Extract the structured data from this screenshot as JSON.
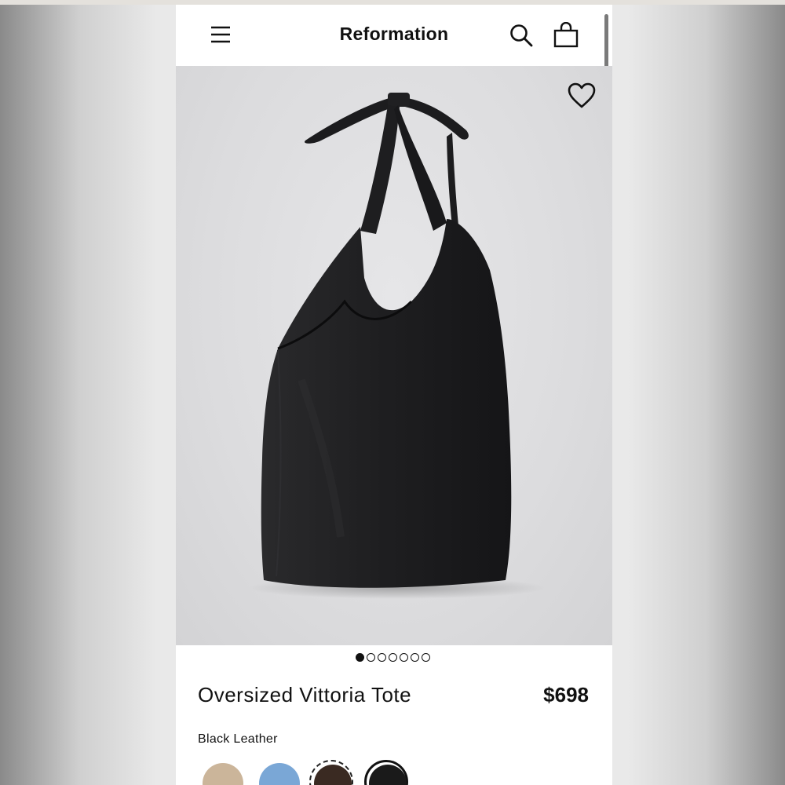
{
  "header": {
    "brand": "Reformation",
    "menu_icon": "hamburger-menu-icon",
    "search_icon": "search-icon",
    "bag_icon": "shopping-bag-icon"
  },
  "hero": {
    "favorite_icon": "heart-outline-icon",
    "image": "black leather tote bag with knotted strap",
    "carousel": {
      "total": 7,
      "active_index": 0
    }
  },
  "product": {
    "name": "Oversized Vittoria Tote",
    "price": "$698",
    "selected_color": "Black Leather"
  },
  "swatches": [
    {
      "color": "#cbb59a",
      "selected": false,
      "style": "plain"
    },
    {
      "color": "#7aa7d6",
      "selected": false,
      "style": "plain"
    },
    {
      "color": "#3a2a22",
      "selected": false,
      "style": "dashed"
    },
    {
      "color": "#1a1a1a",
      "selected": true,
      "style": "solid-ring"
    }
  ],
  "colors": {
    "text": "#111111",
    "hero_bg": "#dcdcde",
    "bag": "#1c1c1e"
  }
}
